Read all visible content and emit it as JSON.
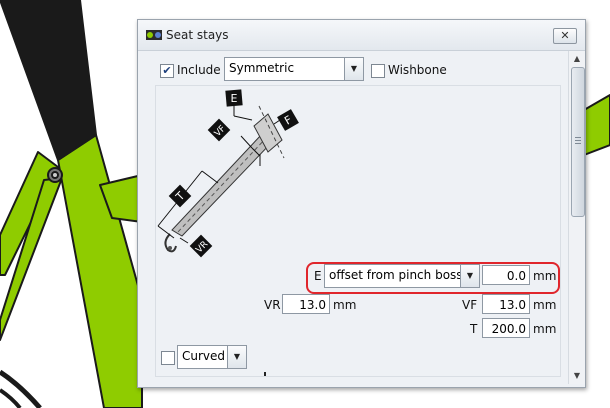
{
  "window": {
    "title": "Seat stays",
    "close_label": "✕"
  },
  "options": {
    "include_label": "Include",
    "include_checked": "✔",
    "symmetry_value": "Symmetric",
    "wishbone_label": "Wishbone",
    "wishbone_checked": ""
  },
  "diagram": {
    "label_e": "E",
    "label_f": "F",
    "label_vf": "VF",
    "label_t": "T",
    "label_vr": "VR"
  },
  "fields": {
    "e_label": "E",
    "e_mode": "offset from pinch boss",
    "e_value": "0.0",
    "e_unit": "mm",
    "vr_label": "VR",
    "vr_value": "13.0",
    "vr_unit": "mm",
    "vf_label": "VF",
    "vf_value": "13.0",
    "vf_unit": "mm",
    "t_label": "T",
    "t_value": "200.0",
    "t_unit": "mm"
  },
  "curved": {
    "label": "Curved",
    "checked": ""
  },
  "colors": {
    "frame_green": "#8fcc00",
    "frame_outline": "#1a1a1a",
    "highlight_red": "#e0262c"
  }
}
